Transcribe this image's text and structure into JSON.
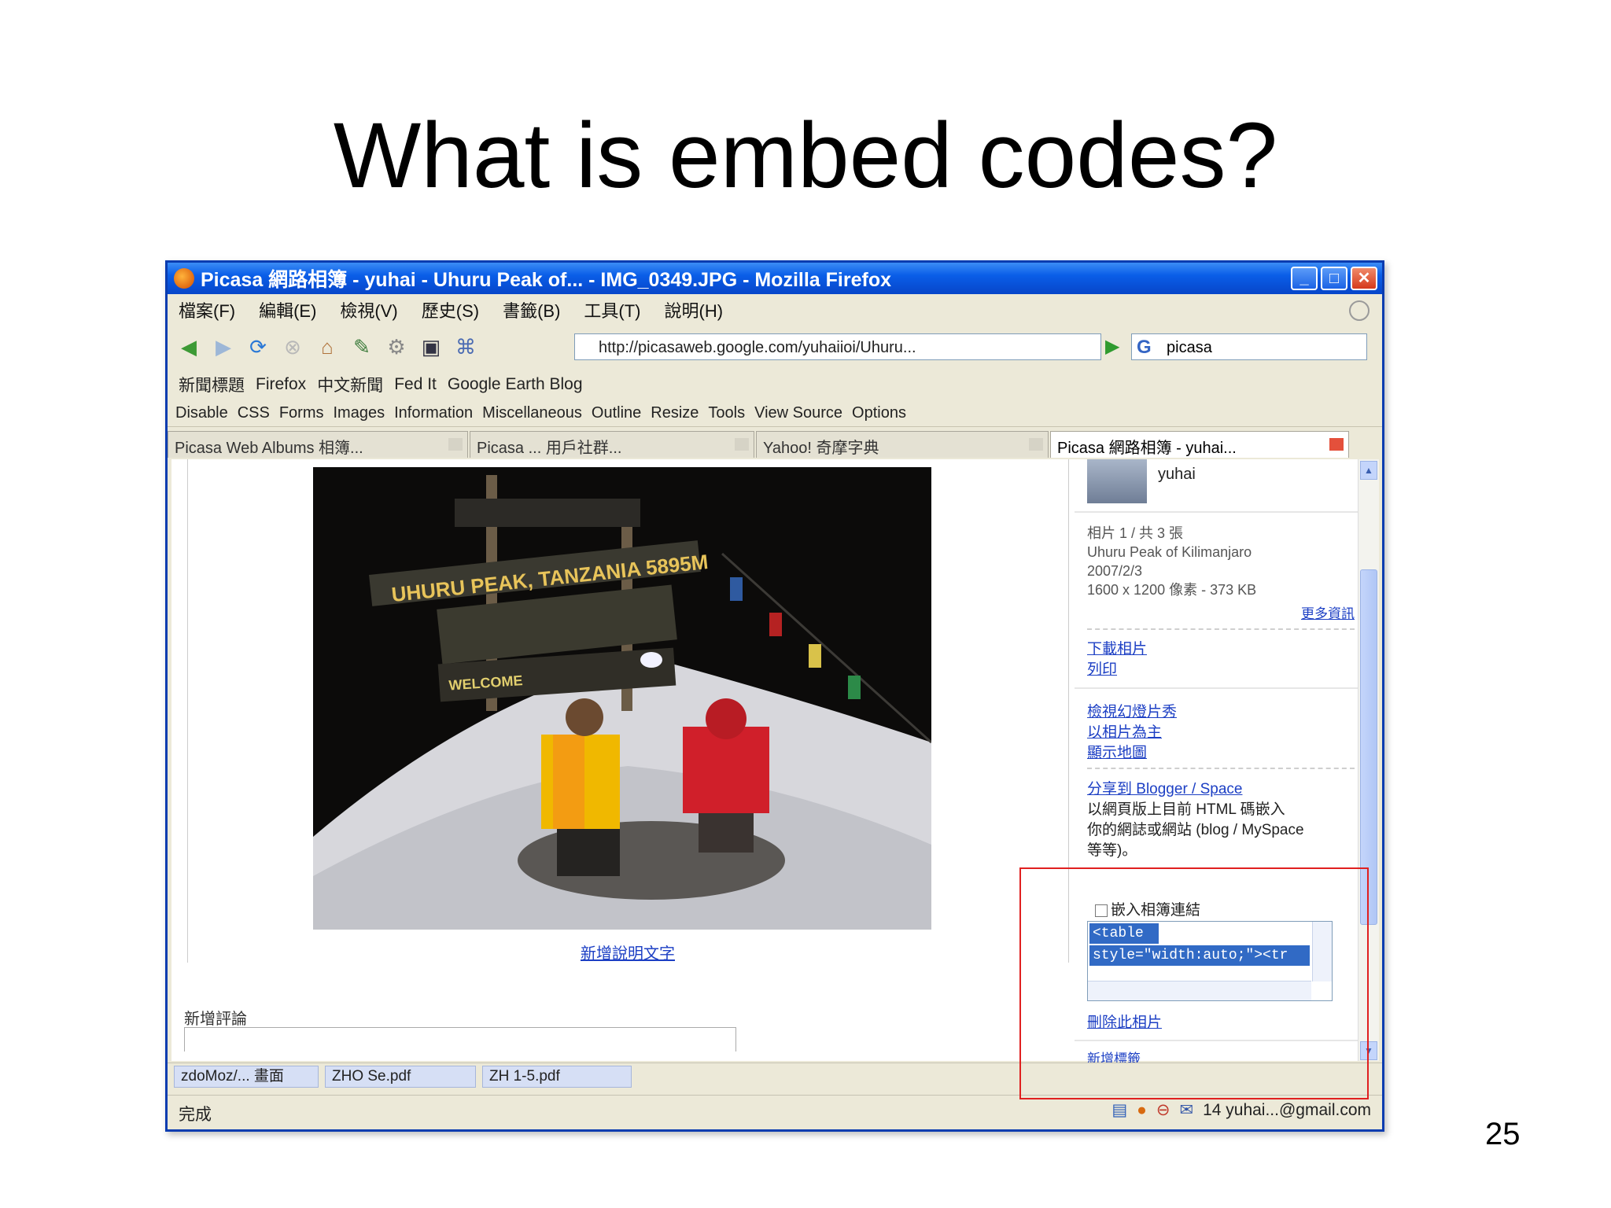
{
  "slide": {
    "title": "What is embed codes?",
    "page_number": "25"
  },
  "window": {
    "title": "Picasa 網路相簿 - yuhai - Uhuru Peak of... - IMG_0349.JPG - Mozilla Firefox",
    "menu": [
      "檔案(F)",
      "編輯(E)",
      "檢視(V)",
      "歷史(S)",
      "書籤(B)",
      "工具(T)",
      "說明(H)"
    ],
    "url": "http://picasaweb.google.com/yuhaiioi/Uhuru...",
    "search_value": "picasa",
    "bookmarks": [
      "新聞標題",
      "Firefox",
      "中文新聞",
      "Fed It",
      "Google Earth Blog"
    ],
    "dev_toolbar": [
      "Disable",
      "CSS",
      "Forms",
      "Images",
      "Information",
      "Miscellaneous",
      "Outline",
      "Resize",
      "Tools",
      "View Source",
      "Options"
    ],
    "tabs": [
      {
        "label": "Picasa Web Albums 相簿...",
        "active": false
      },
      {
        "label": "Picasa ...  用戶社群...",
        "active": false
      },
      {
        "label": "Yahoo! 奇摩字典",
        "active": false
      },
      {
        "label": "Picasa 網路相簿 - yuhai...",
        "active": true
      }
    ]
  },
  "content": {
    "photo_caption": "新增說明文字",
    "comments_label": "新增評論"
  },
  "sidebar": {
    "username": "yuhai",
    "info_lines": [
      "相片 1 / 共 3 張",
      "Uhuru Peak of Kilimanjaro",
      "2007/2/3",
      "1600 x 1200 像素 - 373 KB"
    ],
    "more_info_link": "更多資訊",
    "links1": [
      "下載相片",
      "列印"
    ],
    "links2": [
      "檢視幻燈片秀",
      "以相片為主",
      "顯示地圖"
    ],
    "blog_link": "分享到 Blogger / Space",
    "blog_text_1": "以網頁版上目前 HTML 碼嵌入",
    "blog_text_2": "你的網誌或網站 (blog / MySpace",
    "blog_text_3": "等等)。",
    "embed_checkbox_label": "嵌入相簿連結",
    "embed_line_1": "<table",
    "embed_line_2": "style=\"width:auto;\"><tr",
    "remove_link": "刪除此相片",
    "bottom_link": "新增標籤"
  },
  "taskbar": {
    "items": [
      "zdoMoz/... 畫面",
      "ZHO Se.pdf",
      "ZH 1-5.pdf"
    ]
  },
  "status": {
    "left": "完成",
    "right_email": "14 yuhai...@gmail.com"
  }
}
